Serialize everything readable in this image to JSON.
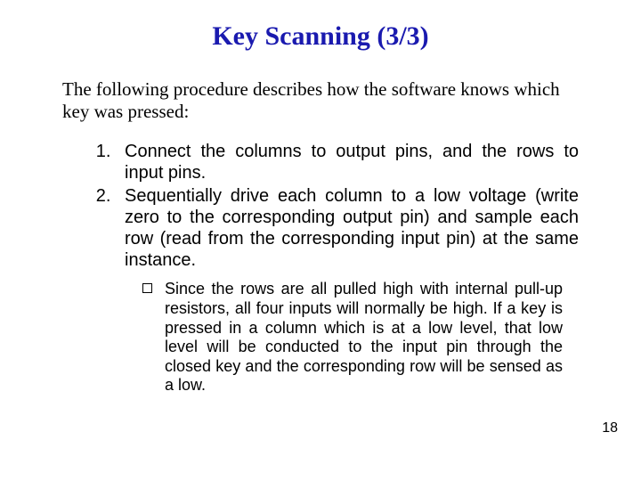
{
  "title": "Key Scanning (3/3)",
  "intro": "The following procedure describes how the software knows which key was pressed:",
  "steps": [
    "Connect the columns to output pins, and the rows to input pins.",
    "Sequentially drive each column to a low voltage (write zero to the corresponding output pin) and sample each row (read from the corresponding input pin) at the same instance."
  ],
  "bullet": "Since the rows are all pulled high with internal pull-up resistors, all four inputs will normally be high. If a key is pressed in a column which is at a low level, that low level will be conducted to the input pin through the closed key and the corresponding row will be sensed as a low.",
  "page_number": "18"
}
